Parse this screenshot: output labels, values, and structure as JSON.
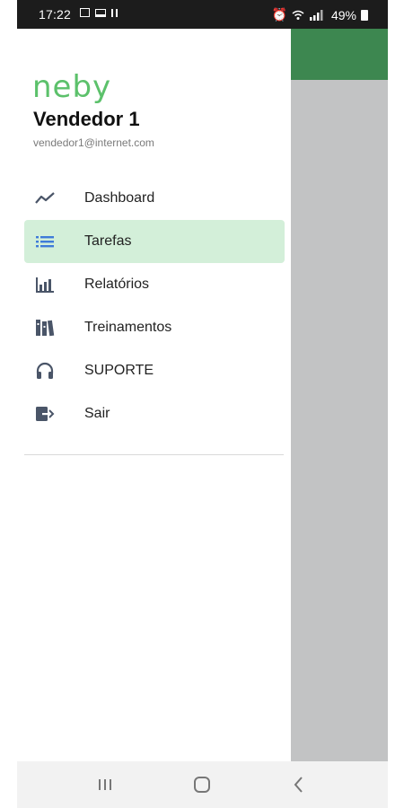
{
  "status_bar": {
    "time": "17:22",
    "battery": "49%"
  },
  "drawer": {
    "logo": "neby",
    "user_name": "Vendedor 1",
    "user_email": "vendedor1@internet.com",
    "items": [
      {
        "label": "Dashboard",
        "icon": "trend-line-icon",
        "active": false
      },
      {
        "label": "Tarefas",
        "icon": "list-icon",
        "active": true
      },
      {
        "label": "Relatórios",
        "icon": "bar-chart-icon",
        "active": false
      },
      {
        "label": "Treinamentos",
        "icon": "books-icon",
        "active": false
      },
      {
        "label": "SUPORTE",
        "icon": "headphones-icon",
        "active": false
      },
      {
        "label": "Sair",
        "icon": "logout-icon",
        "active": false
      }
    ]
  },
  "colors": {
    "brand_green": "#5cc16b",
    "app_bar_green": "#3d8750",
    "active_item_bg": "#d3efd9",
    "icon_color": "#4a5568",
    "active_icon_color": "#3f7bd9"
  },
  "navbar": {
    "icons": [
      "recent-apps-icon",
      "home-icon",
      "back-icon"
    ]
  }
}
